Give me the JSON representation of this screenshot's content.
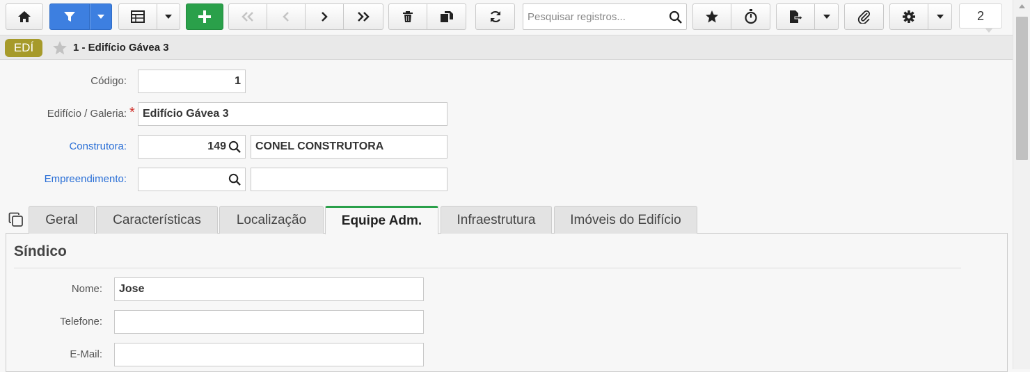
{
  "toolbar": {
    "home_icon": "home-icon",
    "filter_icon": "filter-icon",
    "grid_icon": "grid-view-icon",
    "add_icon": "plus-icon",
    "search_placeholder": "Pesquisar registros...",
    "record_count": "2",
    "colors": {
      "filter": "#3d7fe0",
      "add": "#2aa04a"
    }
  },
  "title_bar": {
    "mode_badge": "EDÍ",
    "record_title": "1 - Edifício Gávea 3",
    "badge_color": "#a69a2a"
  },
  "form": {
    "codigo": {
      "label": "Código:",
      "value": "1"
    },
    "edificio": {
      "label": "Edifício / Galeria:",
      "required_mark": "*",
      "value": "Edifício Gávea 3"
    },
    "construtora": {
      "label": "Construtora:",
      "code": "149",
      "name": "CONEL CONSTRUTORA"
    },
    "empreendimento": {
      "label": "Empreendimento:",
      "code": "",
      "name": ""
    }
  },
  "tabs": [
    {
      "label": "Geral"
    },
    {
      "label": "Características"
    },
    {
      "label": "Localização"
    },
    {
      "label": "Equipe Adm.",
      "active": true
    },
    {
      "label": "Infraestrutura"
    },
    {
      "label": "Imóveis do Edifício"
    }
  ],
  "sindico": {
    "title": "Síndico",
    "nome": {
      "label": "Nome:",
      "value": "Jose"
    },
    "telefone": {
      "label": "Telefone:",
      "value": ""
    },
    "email": {
      "label": "E-Mail:",
      "value": ""
    }
  }
}
